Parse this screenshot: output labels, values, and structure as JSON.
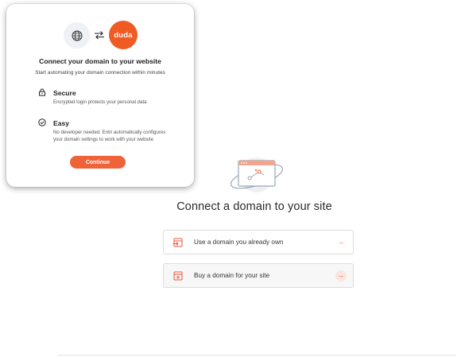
{
  "modal": {
    "brand_logo_text": "duda",
    "title": "Connect your domain to your website",
    "subtitle": "Start automating your domain connection within minutes",
    "features": [
      {
        "icon": "lock-icon",
        "title": "Secure",
        "description": "Encrypted login protects your personal data"
      },
      {
        "icon": "check-circle-icon",
        "title": "Easy",
        "description_line1": "No developer needed. Entri automatically configures",
        "description_line2": "your domain settings to work with your website"
      }
    ],
    "continue_label": "Continue",
    "accent_color": "#f06237"
  },
  "page": {
    "title": "Connect a domain to your site",
    "options": [
      {
        "icon": "domain-import-icon",
        "label": "Use a domain you already own",
        "arrow": "→"
      },
      {
        "icon": "domain-add-icon",
        "label": "Buy a domain for your site",
        "arrow": "→"
      }
    ]
  }
}
